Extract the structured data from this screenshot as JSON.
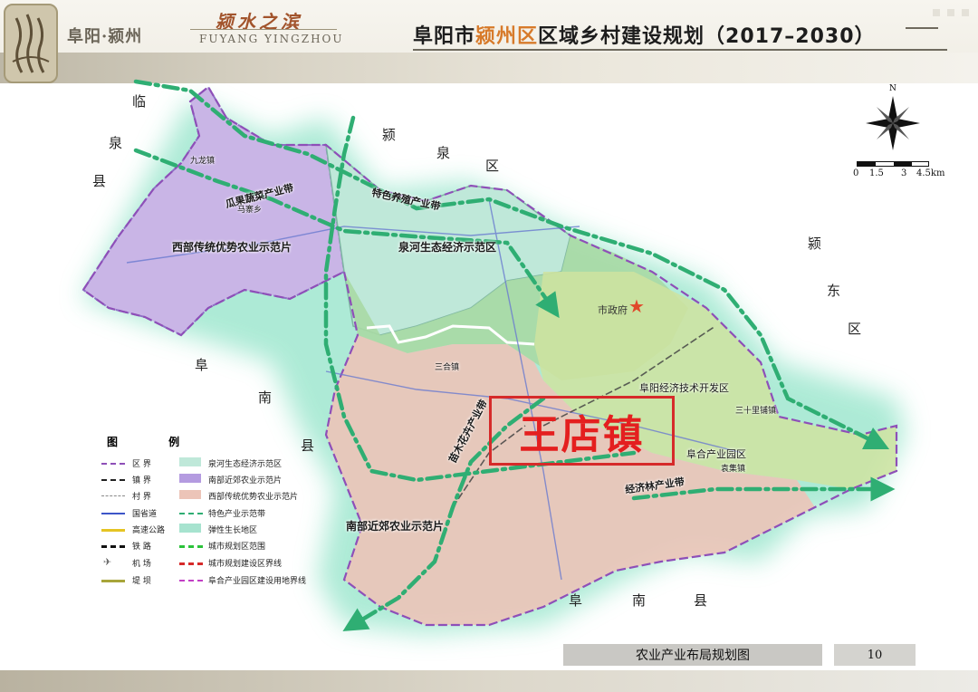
{
  "header": {
    "region_name": "阜阳·颍州",
    "slogan": "颍水之滨",
    "slogan_pinyin": "FUYANG YINGZHOU",
    "title_prefix": "阜阳市",
    "title_highlight": "颍州区",
    "title_suffix": "区域乡村建设规划",
    "title_years": "（2017–2030）"
  },
  "map": {
    "neighbors": [
      {
        "id": "linquan",
        "chars": [
          "临",
          "泉",
          "县"
        ]
      },
      {
        "id": "yingquan",
        "chars": [
          "颍",
          "泉",
          "区"
        ]
      },
      {
        "id": "yingdong",
        "chars": [
          "颍",
          "东",
          "区"
        ]
      },
      {
        "id": "funan_west",
        "chars": [
          "阜",
          "南",
          "县"
        ]
      },
      {
        "id": "funan_south",
        "chars": [
          "阜",
          "南",
          "县"
        ]
      }
    ],
    "zone_labels": [
      "西部传统优势农业示范片",
      "泉河生态经济示范区",
      "南部近郊农业示范片",
      "阜阳经济技术开发区",
      "阜合产业园区"
    ],
    "belt_labels": [
      "瓜果蔬菜产业带",
      "特色养殖产业带",
      "苗木花卉产业带",
      "经济林产业带"
    ],
    "town_labels": [
      "九龙镇",
      "马寨乡",
      "三合镇",
      "三十里铺镇",
      "袁集镇"
    ],
    "city_hall": "市政府",
    "focus_town": "王店镇",
    "colors": {
      "focus_red": "#e41f1f",
      "belt_green": "#2fae73",
      "west_zone_purple": "#c9b5e6",
      "south_zone_pink": "#ecc4b8",
      "quanhe_zone_teal": "#bfe8d9",
      "urban_green": "#a9d9a4",
      "dev_zone_yellow_green": "#cfe3a0"
    }
  },
  "legend": {
    "title": "图 例",
    "items": [
      {
        "label": "区 界",
        "icon": "district-boundary"
      },
      {
        "label": "镇 界",
        "icon": "town-boundary"
      },
      {
        "label": "村 界",
        "icon": "village-boundary"
      },
      {
        "label": "国省道",
        "icon": "national-road"
      },
      {
        "label": "高速公路",
        "icon": "expressway"
      },
      {
        "label": "铁 路",
        "icon": "railway"
      },
      {
        "label": "机 场",
        "icon": "airport"
      },
      {
        "label": "堤 坝",
        "icon": "dike"
      },
      {
        "label": "泉河生态经济示范区",
        "icon": "quanhe-zone-swatch"
      },
      {
        "label": "南部近郊农业示范片",
        "icon": "south-zone-swatch"
      },
      {
        "label": "西部传统优势农业示范片",
        "icon": "west-zone-swatch"
      },
      {
        "label": "特色产业示范带",
        "icon": "industry-belt"
      },
      {
        "label": "弹性生长地区",
        "icon": "flexible-growth-swatch"
      },
      {
        "label": "城市规划区范围",
        "icon": "urban-planning-boundary"
      },
      {
        "label": "城市规划建设区界线",
        "icon": "urban-construction-boundary"
      },
      {
        "label": "阜合产业园区建设用地界线",
        "icon": "fuhe-park-boundary"
      }
    ]
  },
  "compass": {
    "north": "N"
  },
  "scale": {
    "ticks": [
      "0",
      "1.5",
      "3",
      "4.5km"
    ]
  },
  "footer": {
    "caption": "农业产业布局规划图",
    "page": "10"
  }
}
